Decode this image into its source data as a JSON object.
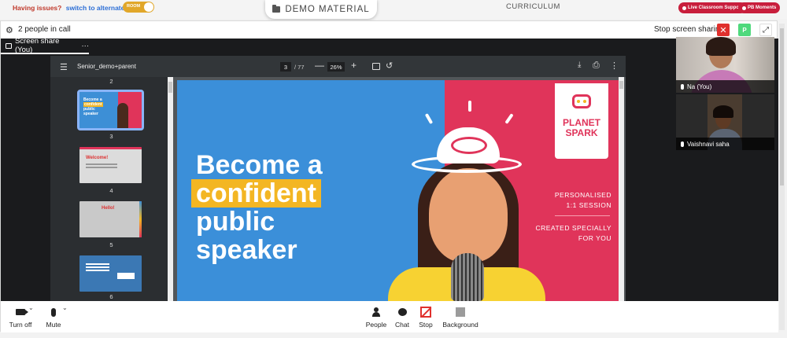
{
  "topbar": {
    "issues_text": "Having issues?",
    "switch_link": "switch to alternate room",
    "toggle_label": "ROOM",
    "demo_tab": "DEMO MATERIAL",
    "curriculum": "CURRICULUM",
    "live_support": "Live Classroom Support",
    "pb_moments": "PB Moments"
  },
  "callbar": {
    "people_count": "2 people in call",
    "stop_share": "Stop screen sharing",
    "avatar_initial": "P"
  },
  "share_tab": {
    "label": "Screen share (You)",
    "more": "···"
  },
  "pdf": {
    "title": "Senior_demo+parent",
    "page": "3",
    "total": "/ 77",
    "zoom": "26%",
    "thumb_labels": [
      "2",
      "3",
      "4",
      "5",
      "6"
    ],
    "thumb_welcome": "Welcome!",
    "thumb_hello": "Hello!",
    "slide": {
      "line1": "Become a",
      "line2": "confident",
      "line3": "public",
      "line4": "speaker",
      "logo_line1": "PLANET",
      "logo_line2": "SPARK",
      "tag1_l1": "PERSONALISED",
      "tag1_l2": "1:1 SESSION",
      "tag2_l1": "CREATED SPECIALLY",
      "tag2_l2": "FOR YOU"
    }
  },
  "participants": [
    {
      "name": "Na (You)"
    },
    {
      "name": "Vaishnavi saha"
    }
  ],
  "controls": {
    "turn_off": "Turn off",
    "mute": "Mute",
    "people": "People",
    "chat": "Chat",
    "stop": "Stop",
    "background": "Background"
  },
  "colors": {
    "accent_red": "#e0302d",
    "slide_blue": "#3b8fd9",
    "slide_red": "#e0345a",
    "slide_yellow": "#f3b623"
  }
}
